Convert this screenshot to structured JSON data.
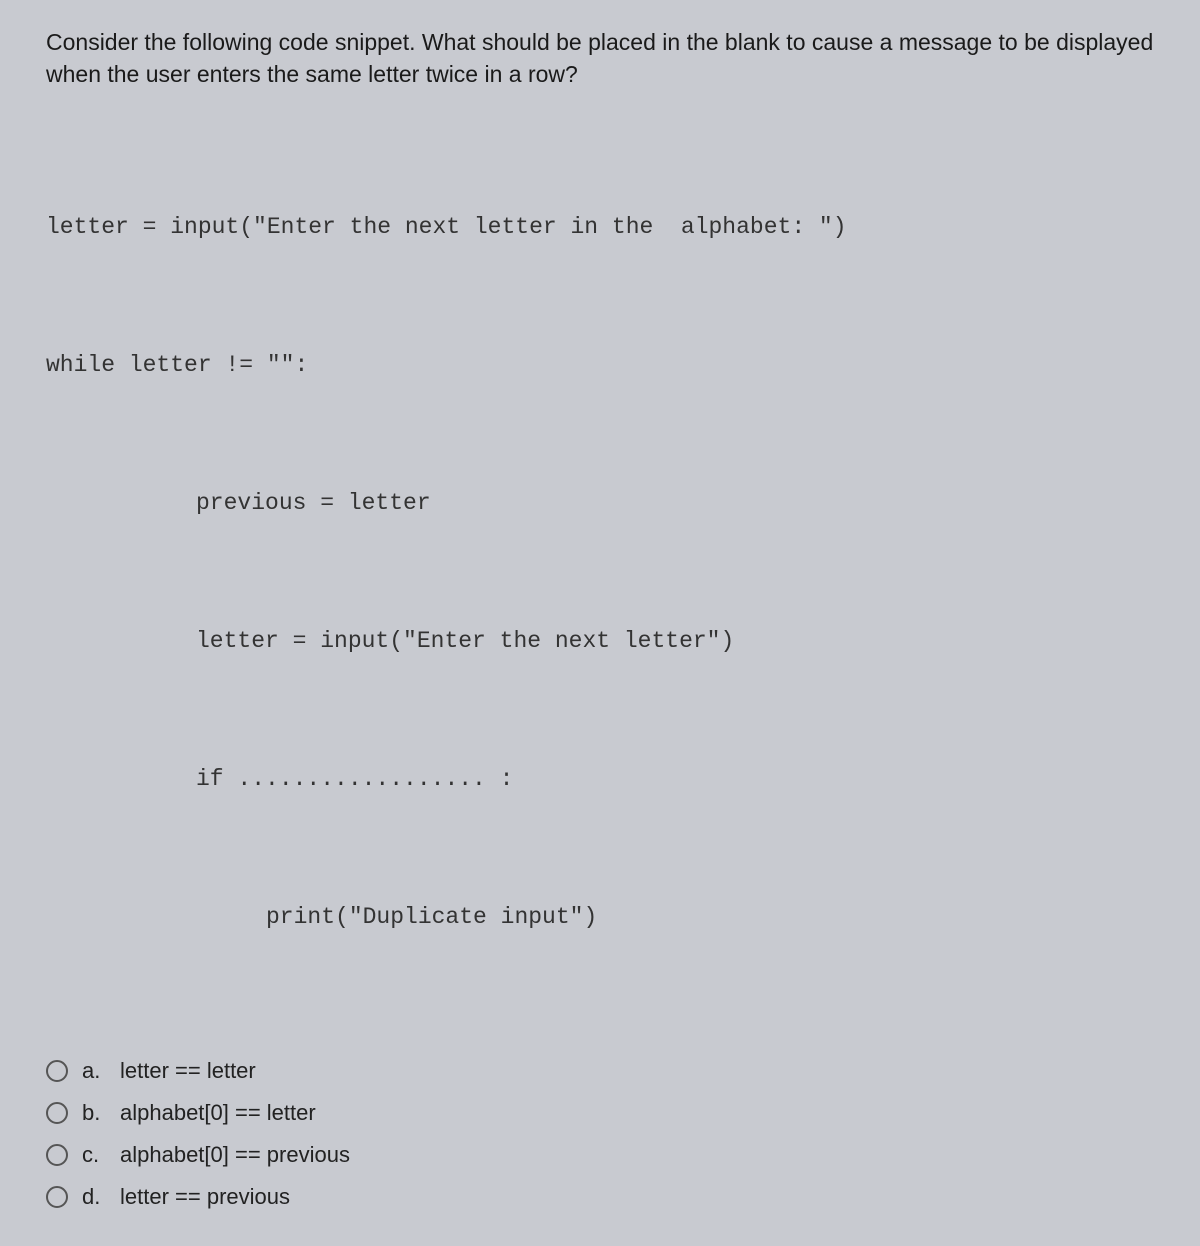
{
  "question": "Consider the following code snippet. What should be placed in the blank to cause a message to be displayed when the user enters the same letter twice in a row?",
  "code": {
    "l1": "letter = input(\"Enter the next letter in the  alphabet: \")",
    "l2": "while letter != \"\":",
    "l3": "previous = letter",
    "l4": "letter = input(\"Enter the next letter\")",
    "l5": "if .................. :",
    "l6": "print(\"Duplicate input\")"
  },
  "options": [
    {
      "letter": "a.",
      "text": "letter == letter"
    },
    {
      "letter": "b.",
      "text": "alphabet[0] == letter"
    },
    {
      "letter": "c.",
      "text": "alphabet[0] == previous"
    },
    {
      "letter": "d.",
      "text": "letter == previous"
    }
  ]
}
